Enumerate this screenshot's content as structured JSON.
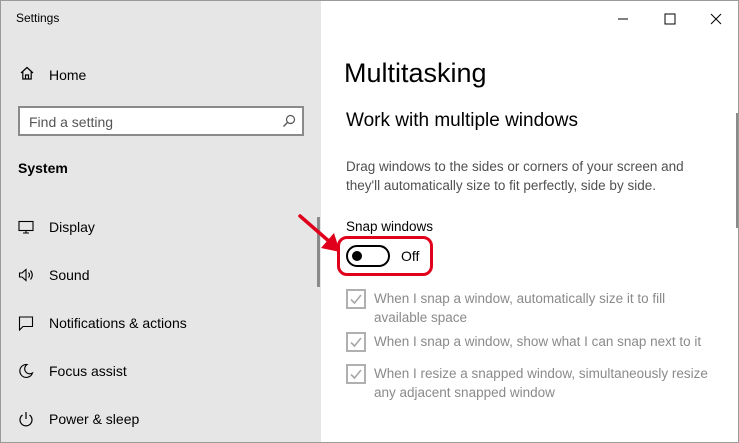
{
  "window": {
    "app_title": "Settings"
  },
  "sidebar": {
    "home_label": "Home",
    "search_placeholder": "Find a setting",
    "section": "System",
    "items": [
      {
        "label": "Display",
        "icon": "display-icon"
      },
      {
        "label": "Sound",
        "icon": "speaker-icon"
      },
      {
        "label": "Notifications & actions",
        "icon": "notification-icon"
      },
      {
        "label": "Focus assist",
        "icon": "moon-icon"
      },
      {
        "label": "Power & sleep",
        "icon": "power-icon"
      }
    ]
  },
  "main": {
    "title": "Multitasking",
    "subtitle": "Work with multiple windows",
    "description": "Drag windows to the sides or corners of your screen and they'll automatically size to fit perfectly, side by side.",
    "snap_label": "Snap windows",
    "snap_state": "Off",
    "options": [
      {
        "text": "When I snap a window, automatically size it to fill available space",
        "checked": true
      },
      {
        "text": "When I snap a window, show what I can snap next to it",
        "checked": true
      },
      {
        "text": "When I resize a snapped window, simultaneously resize any adjacent snapped window",
        "checked": true
      }
    ]
  },
  "colors": {
    "highlight": "#e0001b",
    "sidebar_bg": "#e6e6e6"
  }
}
